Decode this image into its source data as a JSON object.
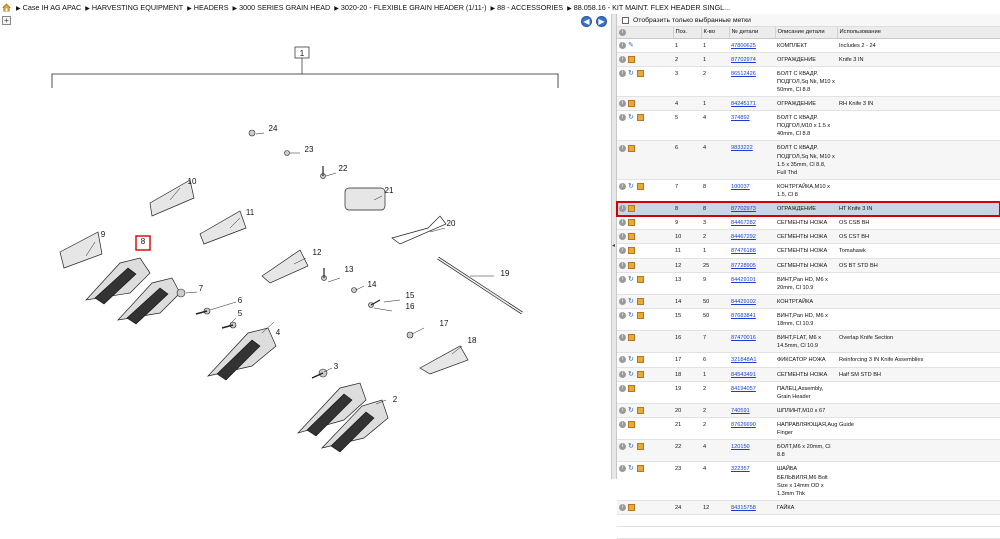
{
  "breadcrumb": [
    "Case IH AG APAC",
    "HARVESTING EQUIPMENT",
    "HEADERS",
    "3000 SERIES GRAIN HEAD",
    "3020-20 - FLEXIBLE GRAIN HEADER (1/11-)",
    "88 - ACCESSORIES",
    "88.058.16 - KIT MAINT. FLEX HEADER SINGL..."
  ],
  "filter": {
    "label": "Отобразить только выбранные метки"
  },
  "columns": {
    "pos": "Поз.",
    "qty": "К-во",
    "part": "№ детали",
    "desc": "Описание детали",
    "usage": "Использование"
  },
  "icons": {
    "home": "home-icon",
    "info": "info-icon",
    "wrench": "wrench-icon",
    "box": "box-icon",
    "cycle": "substitute-icon"
  },
  "colors": {
    "link": "#1a3fd0",
    "selection_outline": "#d40000",
    "selected_row": "#c9d6e6",
    "nav_button": "#3b73c8"
  },
  "diagram": {
    "labels": [
      "1",
      "2",
      "3",
      "4",
      "5",
      "6",
      "7",
      "8",
      "9",
      "10",
      "11",
      "12",
      "13",
      "14",
      "15",
      "16",
      "17",
      "18",
      "19",
      "20",
      "21",
      "22",
      "23",
      "24"
    ],
    "highlighted": "8"
  },
  "parts": [
    {
      "pos": "1",
      "qty": "1",
      "part": "47800625",
      "desc": "КОМПЛЕКТ",
      "usage": "Includes 2 - 24",
      "icons": [
        "info",
        "wrench"
      ]
    },
    {
      "pos": "2",
      "qty": "1",
      "part": "87702974",
      "desc": "ОГРАЖДЕНИЕ",
      "usage": "Knife 3 IN",
      "icons": [
        "info",
        "box"
      ]
    },
    {
      "pos": "3",
      "qty": "2",
      "part": "86512426",
      "desc": "БОЛТ С КВАДР. ПОДГОЛ,Sq Nk, M10 x 50mm, Cl 8.8",
      "usage": "",
      "icons": [
        "info",
        "cycle",
        "box"
      ]
    },
    {
      "pos": "4",
      "qty": "1",
      "part": "84245171",
      "desc": "ОГРАЖДЕНИЕ",
      "usage": "RH Knife 3 IN",
      "icons": [
        "info",
        "box"
      ]
    },
    {
      "pos": "5",
      "qty": "4",
      "part": "374892",
      "desc": "БОЛТ С КВАДР. ПОДГОЛ,M10 x 1.5 x 40mm, Cl 8.8",
      "usage": "",
      "icons": [
        "info",
        "cycle",
        "box"
      ]
    },
    {
      "pos": "6",
      "qty": "4",
      "part": "9833222",
      "desc": "БОЛТ С КВАДР. ПОДГОЛ,Sq Nk, M10 x 1.5 x 35mm, Cl 8.8, Full Thd",
      "usage": "",
      "icons": [
        "info",
        "box"
      ]
    },
    {
      "pos": "7",
      "qty": "8",
      "part": "100037",
      "desc": "КОНТРГАЙКА,M10 x 1.5, Cl 8",
      "usage": "",
      "icons": [
        "info",
        "cycle",
        "box"
      ]
    },
    {
      "pos": "8",
      "qty": "8",
      "part": "87702973",
      "desc": "ОГРАЖДЕНИЕ",
      "usage": "HT Knife 3 IN",
      "icons": [
        "info",
        "box"
      ],
      "selected": true
    },
    {
      "pos": "9",
      "qty": "3",
      "part": "84467282",
      "desc": "СЕГМЕНТЫ НОЖА",
      "usage": "OS CSB BH",
      "icons": [
        "info",
        "box"
      ]
    },
    {
      "pos": "10",
      "qty": "2",
      "part": "84467292",
      "desc": "СЕГМЕНТЫ НОЖА",
      "usage": "OS CST BH",
      "icons": [
        "info",
        "box"
      ]
    },
    {
      "pos": "11",
      "qty": "1",
      "part": "87476188",
      "desc": "СЕГМЕНТЫ НОЖА",
      "usage": "Tomahawk",
      "icons": [
        "info",
        "box"
      ]
    },
    {
      "pos": "12",
      "qty": "25",
      "part": "87728905",
      "desc": "СЕГМЕНТЫ НОЖА",
      "usage": "OS BT STD BH",
      "icons": [
        "info",
        "box"
      ]
    },
    {
      "pos": "13",
      "qty": "9",
      "part": "84429101",
      "desc": "ВИНТ,Pan HD, M6 x 20mm, Cl 10.9",
      "usage": "",
      "icons": [
        "info",
        "cycle",
        "box"
      ]
    },
    {
      "pos": "14",
      "qty": "50",
      "part": "84429102",
      "desc": "КОНТРГАЙКА",
      "usage": "",
      "icons": [
        "info",
        "cycle",
        "box"
      ]
    },
    {
      "pos": "15",
      "qty": "50",
      "part": "87683841",
      "desc": "ВИНТ,Pan HD, M6 x 18mm, Cl 10.9",
      "usage": "",
      "icons": [
        "info",
        "cycle",
        "box"
      ]
    },
    {
      "pos": "16",
      "qty": "7",
      "part": "87470016",
      "desc": "ВИНТ,FLAT, M6 x 14.5mm, Cl 10.9",
      "usage": "Overlap Knife Section",
      "icons": [
        "info",
        "box"
      ]
    },
    {
      "pos": "17",
      "qty": "6",
      "part": "321848A1",
      "desc": "ФИКСАТОР НОЖА",
      "usage": "Reinforcing 3 IN Knife Assemblies",
      "icons": [
        "info",
        "cycle",
        "box"
      ]
    },
    {
      "pos": "18",
      "qty": "1",
      "part": "84543491",
      "desc": "СЕГМЕНТЫ НОЖА",
      "usage": "Half SM STD BH",
      "icons": [
        "info",
        "cycle",
        "box"
      ]
    },
    {
      "pos": "19",
      "qty": "2",
      "part": "84194057",
      "desc": "ПАЛЕЦ,Assembly, Grain Header",
      "usage": "",
      "icons": [
        "info",
        "box"
      ]
    },
    {
      "pos": "20",
      "qty": "2",
      "part": "740591",
      "desc": "ШПЛИНТ,M10 x 67",
      "usage": "",
      "icons": [
        "info",
        "cycle",
        "box"
      ]
    },
    {
      "pos": "21",
      "qty": "2",
      "part": "87626690",
      "desc": "НАПРАВЛЯЮЩАЯ,Auger Finger",
      "usage": "Guide",
      "icons": [
        "info",
        "box"
      ]
    },
    {
      "pos": "22",
      "qty": "4",
      "part": "120150",
      "desc": "БОЛТ,M6 x 20mm, Cl 8.8",
      "usage": "",
      "icons": [
        "info",
        "cycle",
        "box"
      ]
    },
    {
      "pos": "23",
      "qty": "4",
      "part": "322357",
      "desc": "ШАЙБА БЕЛЬВИЛЯ,M6 Bolt Size x 14mm OD x 1.3mm Thk",
      "usage": "",
      "icons": [
        "info",
        "cycle",
        "box"
      ]
    },
    {
      "pos": "24",
      "qty": "12",
      "part": "84315758",
      "desc": "ГАЙКА",
      "usage": "",
      "icons": [
        "info",
        "box"
      ]
    }
  ]
}
